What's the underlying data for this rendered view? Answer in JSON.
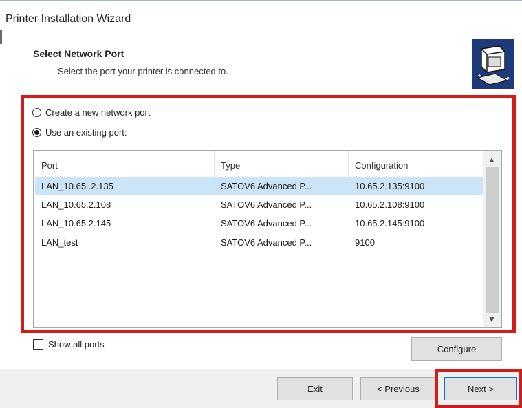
{
  "window": {
    "title": "Printer Installation Wizard"
  },
  "header": {
    "title": "Select Network Port",
    "subtitle": "Select the port your printer is connected to."
  },
  "port_choice": {
    "create_new": {
      "label": "Create a new network port",
      "checked": false
    },
    "use_existing": {
      "label": "Use an existing port:",
      "checked": true
    }
  },
  "port_list": {
    "columns": [
      "Port",
      "Type",
      "Configuration"
    ],
    "rows": [
      {
        "port": "LAN_10.65..2.135",
        "type": "SATOV6 Advanced P...",
        "config": "10.65.2.135:9100",
        "selected": true
      },
      {
        "port": "LAN_10.65.2.108",
        "type": "SATOV6 Advanced P...",
        "config": "10.65.2.108:9100",
        "selected": false
      },
      {
        "port": "LAN_10.65.2.145",
        "type": "SATOV6 Advanced P...",
        "config": "10.65.2.145:9100",
        "selected": false
      },
      {
        "port": "LAN_test",
        "type": "SATOV6 Advanced P...",
        "config": "9100",
        "selected": false
      }
    ]
  },
  "show_all_ports": {
    "label": "Show all ports",
    "checked": false
  },
  "buttons": {
    "configure": "Configure",
    "exit": "Exit",
    "previous": "< Previous",
    "next": "Next >"
  },
  "icons": {
    "wizard": "printer-setup-icon",
    "scroll_up": "chevron-up-icon",
    "scroll_down": "chevron-down-icon"
  },
  "colors": {
    "highlight": "#d51a1a",
    "selection": "#cce4f7",
    "icon_background": "#1e3a7a"
  }
}
